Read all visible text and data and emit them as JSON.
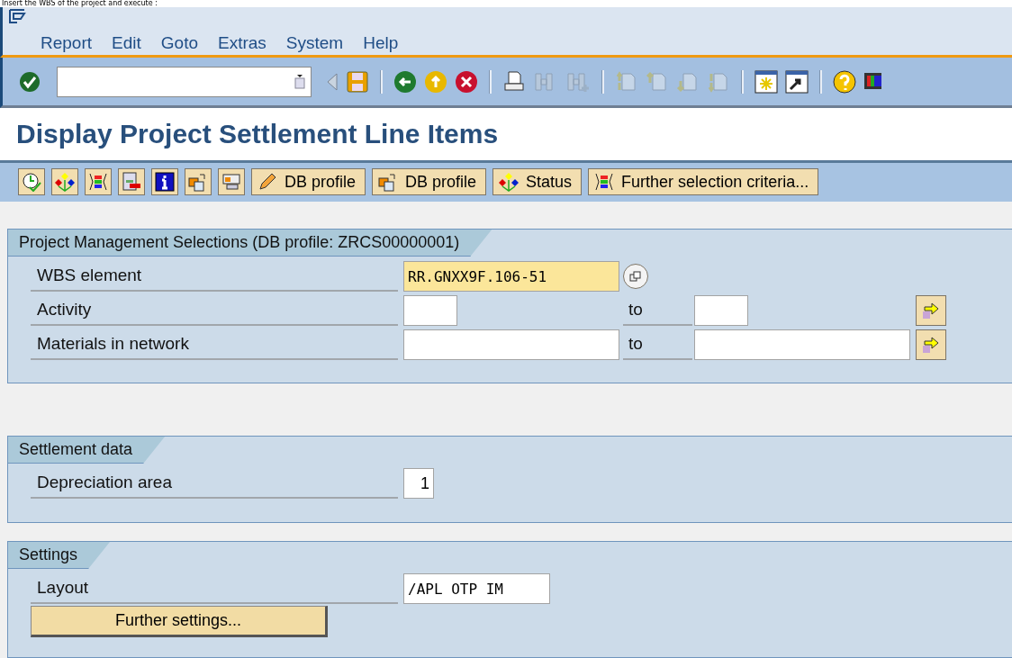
{
  "caption": "Insert the WBS of the project and execute :",
  "menu": [
    "Report",
    "Edit",
    "Goto",
    "Extras",
    "System",
    "Help"
  ],
  "title": "Display Project Settlement Line Items",
  "app_buttons": [
    "DB profile",
    "DB profile",
    "Status",
    "Further selection criteria..."
  ],
  "groups": [
    {
      "title": "Project Management Selections (DB profile: ZRCS00000001)",
      "rows": [
        {
          "kind": "wide",
          "label": "WBS element",
          "value": "RR.GNXX9F.106-51",
          "focused": true
        },
        {
          "kind": "short_range",
          "label": "Activity",
          "to_label": "to"
        },
        {
          "kind": "long_range",
          "label": "Materials in network",
          "to_label": "to"
        }
      ]
    },
    {
      "title": "Settlement data",
      "rows": [
        {
          "kind": "tiny",
          "label": "Depreciation area",
          "value": "1",
          "focused": false
        }
      ]
    },
    {
      "title": "Settings",
      "rows": [
        {
          "kind": "medium",
          "label": "Layout",
          "value": "/APL OTP IM",
          "focused": false
        }
      ],
      "button": "Further settings..."
    }
  ]
}
